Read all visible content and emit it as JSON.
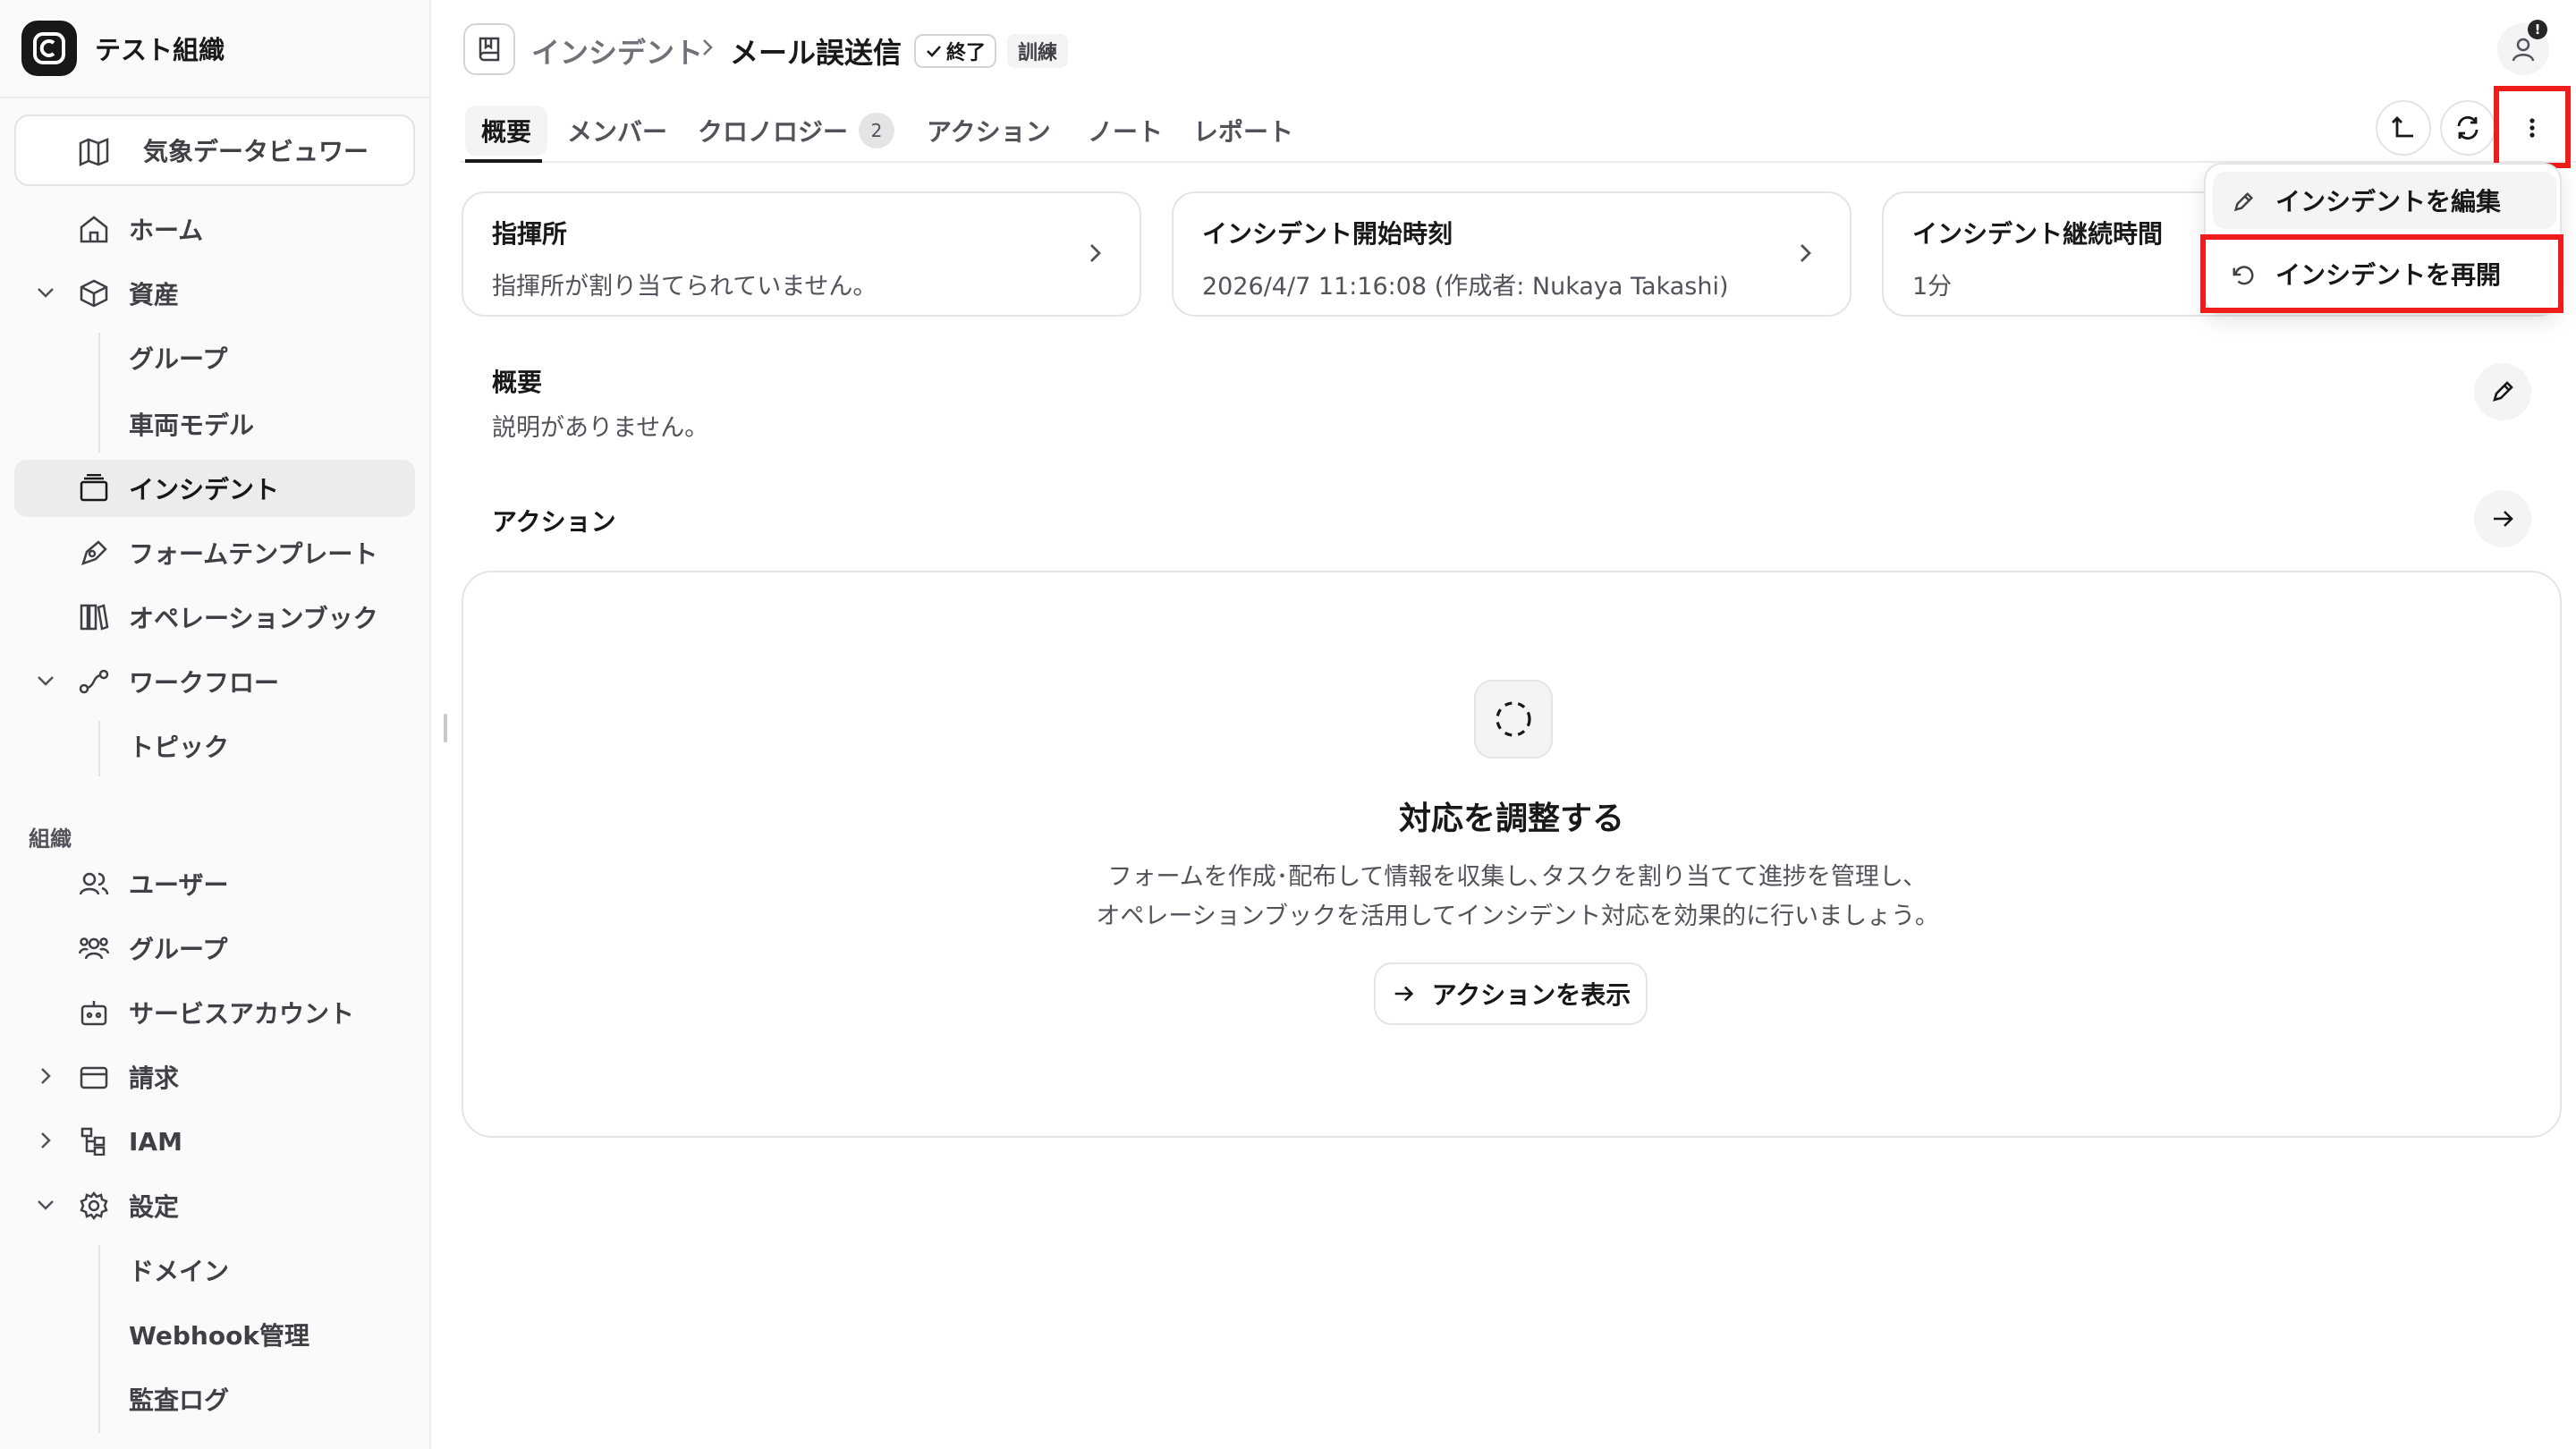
{
  "org": {
    "name": "テスト組織"
  },
  "sidebar": {
    "weather_button": "気象データビュワー",
    "items": [
      {
        "label": "ホーム"
      },
      {
        "label": "資産"
      },
      {
        "label": "グループ"
      },
      {
        "label": "車両モデル"
      },
      {
        "label": "インシデント"
      },
      {
        "label": "フォームテンプレート"
      },
      {
        "label": "オペレーションブック"
      },
      {
        "label": "ワークフロー"
      },
      {
        "label": "トピック"
      }
    ],
    "section_label": "組織",
    "org_items": [
      {
        "label": "ユーザー"
      },
      {
        "label": "グループ"
      },
      {
        "label": "サービスアカウント"
      },
      {
        "label": "請求"
      },
      {
        "label": "IAM"
      },
      {
        "label": "設定"
      },
      {
        "label": "ドメイン"
      },
      {
        "label": "Webhook管理"
      },
      {
        "label": "監査ログ"
      }
    ]
  },
  "header": {
    "breadcrumb_parent": "インシデント",
    "title": "メール誤送信",
    "status_badge": "終了",
    "type_badge": "訓練",
    "notification_mark": "!"
  },
  "tabs": [
    {
      "label": "概要"
    },
    {
      "label": "メンバー"
    },
    {
      "label": "クロノロジー",
      "count": "2"
    },
    {
      "label": "アクション"
    },
    {
      "label": "ノート"
    },
    {
      "label": "レポート"
    }
  ],
  "cards": [
    {
      "title": "指揮所",
      "value": "指揮所が割り当てられていません。"
    },
    {
      "title": "インシデント開始時刻",
      "value": "2026/4/7 11:16:08 (作成者: Nukaya Takashi)"
    },
    {
      "title": "インシデント継続時間",
      "value": "1分"
    }
  ],
  "overview": {
    "title": "概要",
    "description": "説明がありません。"
  },
  "actions": {
    "title": "アクション",
    "empty_title": "対応を調整する",
    "empty_desc_line1": "フォームを作成･配布して情報を収集し､タスクを割り当てて進捗を管理し､",
    "empty_desc_line2": "オペレーションブックを活用してインシデント対応を効果的に行いましょう｡",
    "show_button": "アクションを表示"
  },
  "menu": {
    "edit": "インシデントを編集",
    "reopen": "インシデントを再開"
  },
  "colors": {
    "highlight": "#ef1c1c",
    "active_bg": "#ececee"
  }
}
